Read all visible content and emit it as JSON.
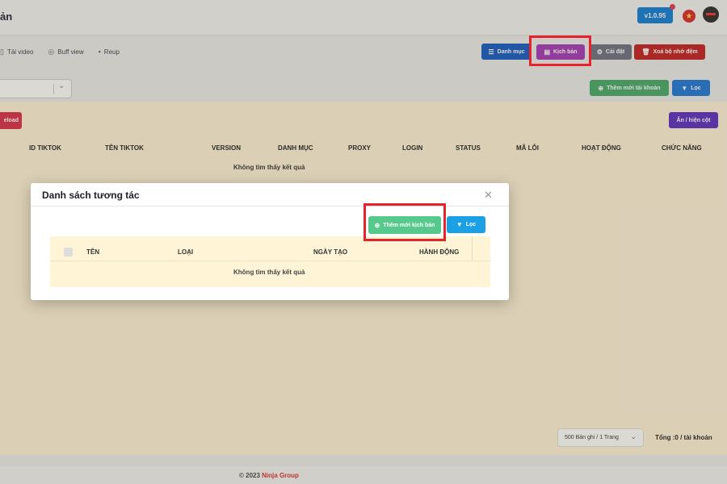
{
  "header": {
    "title": "ản",
    "version": "v1.0.95"
  },
  "tabs": [
    {
      "label": "Tải video",
      "icon": "download-icon"
    },
    {
      "label": "Buff view",
      "icon": "eye-icon"
    },
    {
      "label": "Reup",
      "icon": "reup-icon"
    }
  ],
  "toolbar": {
    "danh_muc": "Danh mục",
    "kich_ban": "Kịch bản",
    "cai_dat": "Cài đặt",
    "xoa_bo_nho": "Xoá bộ nhớ đệm",
    "them_tai_khoan": "Thêm mới tài khoản",
    "loc": "Lọc",
    "reload": "eload",
    "an_hien_cot": "Ẩn / hiện cột"
  },
  "table": {
    "columns": [
      "ID TIKTOK",
      "TÊN TIKTOK",
      "VERSION",
      "DANH MỤC",
      "PROXY",
      "LOGIN",
      "STATUS",
      "MÃ LỖI",
      "HOẠT ĐỘNG",
      "CHỨC NĂNG"
    ],
    "empty_text": "Không tìm thấy kết quả"
  },
  "pagination": {
    "per_page": "500 Bản ghi / 1 Trang",
    "total": "Tổng :0 / tài khoản"
  },
  "footer": {
    "copyright": "© 2023",
    "brand": "Ninja Group"
  },
  "modal": {
    "title": "Danh sách tương tác",
    "add_button": "Thêm mới kịch bản",
    "filter_button": "Lọc",
    "columns": [
      "TÊN",
      "LOẠI",
      "NGÀY TẠO",
      "HÀNH ĐỘNG"
    ],
    "empty_text": "Không tìm thấy kết quả"
  },
  "colors": {
    "highlight": "#e8222a",
    "card_bg": "#fff4d9",
    "primary": "#1259c4",
    "kich_ban": "#a237b6",
    "danger": "#c01e22",
    "success": "#43a86a"
  }
}
